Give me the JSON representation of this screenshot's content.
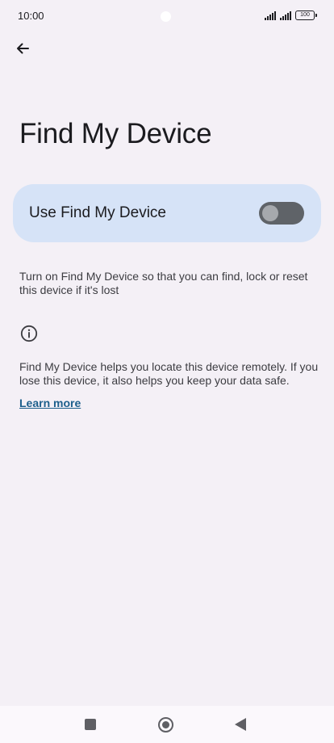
{
  "status_bar": {
    "time": "10:00",
    "battery": "100"
  },
  "title": "Find My Device",
  "toggle": {
    "label": "Use Find My Device",
    "state": "off"
  },
  "description": "Turn on Find My Device so that you can find, lock or reset this device if it's lost",
  "help_text": "Find My Device helps you locate this device remotely. If you lose this device, it also helps you keep your data safe.",
  "learn_more": "Learn more",
  "icons": {
    "back": "arrow-left-icon",
    "info": "info-icon",
    "nav_recents": "square-icon",
    "nav_home": "circle-icon",
    "nav_back": "triangle-back-icon"
  },
  "colors": {
    "background": "#f4f0f6",
    "card": "#d6e3f7",
    "switch_track": "#5f6368",
    "link": "#1d5f8c"
  }
}
